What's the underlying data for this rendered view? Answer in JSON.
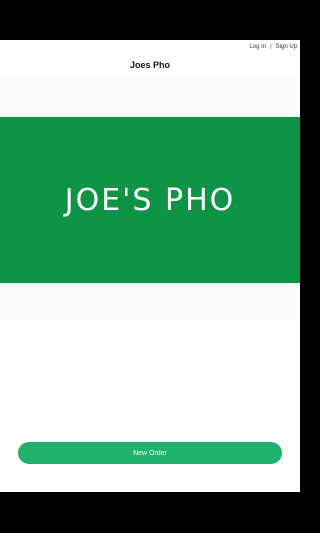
{
  "header": {
    "login_label": "Log In",
    "separator": "|",
    "signup_label": "Sign Up",
    "title": "Joes Pho"
  },
  "banner": {
    "logo_text": "JOE'S PHO",
    "background_color": "#0f9447"
  },
  "actions": {
    "new_order_label": "New Order",
    "button_color": "#1eb26d"
  }
}
